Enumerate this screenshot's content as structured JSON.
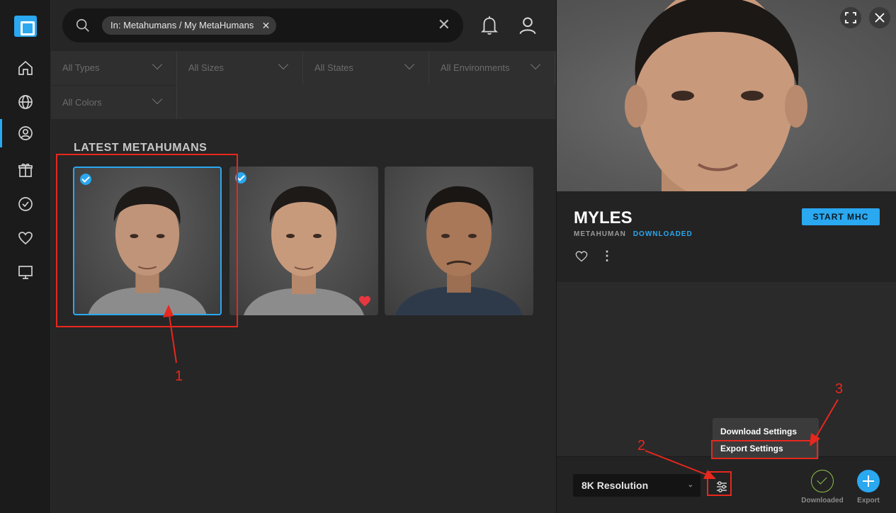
{
  "search": {
    "chip_label": "In: Metahumans / My MetaHumans",
    "chip_close": "✕",
    "clear": "✕"
  },
  "filters": [
    {
      "label": "All Types"
    },
    {
      "label": "All Sizes"
    },
    {
      "label": "All States"
    },
    {
      "label": "All Environments"
    },
    {
      "label": "All Colors"
    }
  ],
  "section_title": "LATEST METAHUMANS",
  "cards": [
    {
      "selected": true,
      "downloaded": true,
      "favorite": false
    },
    {
      "selected": false,
      "downloaded": true,
      "favorite": true
    },
    {
      "selected": false,
      "downloaded": false,
      "favorite": false
    }
  ],
  "detail": {
    "name": "MYLES",
    "type": "METAHUMAN",
    "state": "DOWNLOADED",
    "start_button": "START MHC",
    "more": "⋮",
    "resolution": "8K Resolution",
    "resolution_chevron": "⌄",
    "downloaded_label": "Downloaded",
    "export_label": "Export"
  },
  "settings_menu": {
    "items": [
      "Download Settings",
      "Export Settings"
    ]
  },
  "annotations": [
    "1",
    "2",
    "3"
  ],
  "colors": {
    "accent": "#2aa8f0",
    "annotation": "#e8271d",
    "favorite": "#e8373f",
    "downloaded": "#8fc14a"
  }
}
